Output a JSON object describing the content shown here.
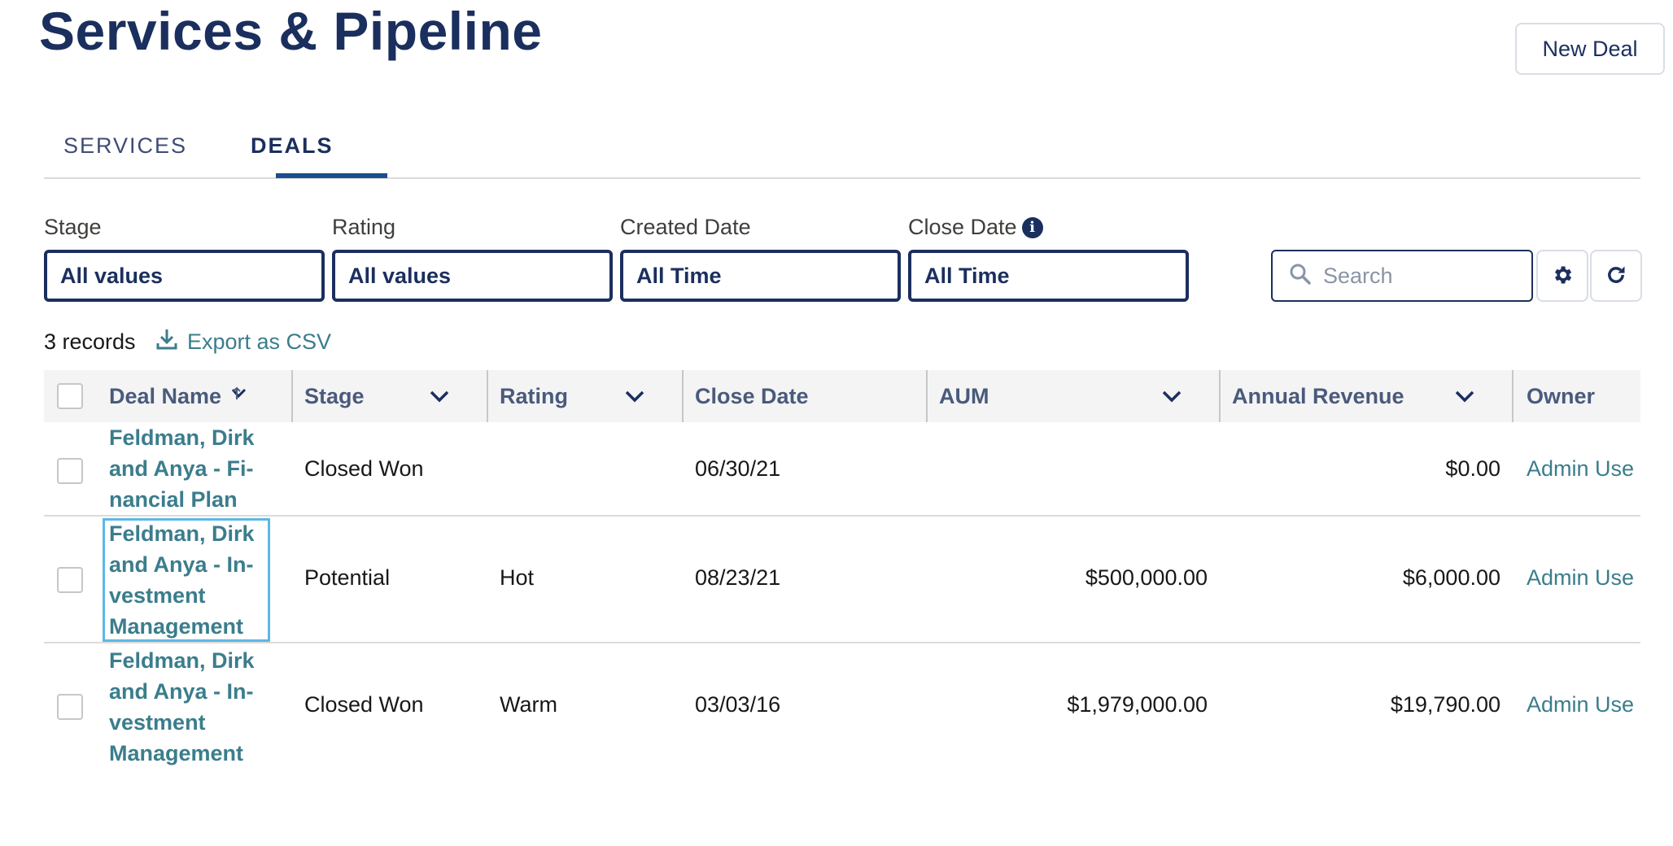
{
  "header": {
    "title": "Services & Pipeline",
    "new_deal_label": "New Deal"
  },
  "tabs": [
    {
      "label": "SERVICES",
      "active": false
    },
    {
      "label": "DEALS",
      "active": true
    }
  ],
  "filters": {
    "stage": {
      "label": "Stage",
      "value": "All values"
    },
    "rating": {
      "label": "Rating",
      "value": "All values"
    },
    "created_date": {
      "label": "Created Date",
      "value": "All Time"
    },
    "close_date": {
      "label": "Close Date",
      "value": "All Time",
      "info_icon": "info-icon"
    }
  },
  "search": {
    "placeholder": "Search",
    "value": ""
  },
  "toolbar": {
    "settings_icon": "gear-icon",
    "refresh_icon": "refresh-icon"
  },
  "summary": {
    "records": "3 records",
    "export_label": "Export as CSV"
  },
  "table": {
    "columns": [
      "Deal Name",
      "Stage",
      "Rating",
      "Close Date",
      "AUM",
      "Annual Revenue",
      "Owner"
    ],
    "rows": [
      {
        "deal_name": "Feldman, Dirk and Anya - Fi-nancial Plan",
        "stage": "Closed Won",
        "rating": "",
        "close_date": "06/30/21",
        "aum": "",
        "annual_revenue": "$0.00",
        "owner": "Admin Use"
      },
      {
        "deal_name": "Feldman, Dirk and Anya - In-vestment Management",
        "stage": "Potential",
        "rating": "Hot",
        "close_date": "08/23/21",
        "aum": "$500,000.00",
        "annual_revenue": "$6,000.00",
        "owner": "Admin Use"
      },
      {
        "deal_name": "Feldman, Dirk and Anya - In-vestment Management",
        "stage": "Closed Won",
        "rating": "Warm",
        "close_date": "03/03/16",
        "aum": "$1,979,000.00",
        "annual_revenue": "$19,790.00",
        "owner": "Admin Use"
      }
    ]
  },
  "colors": {
    "brand_navy": "#1b2f5e",
    "link_teal": "#3b7d8c",
    "focus_blue": "#5cb8e6"
  }
}
